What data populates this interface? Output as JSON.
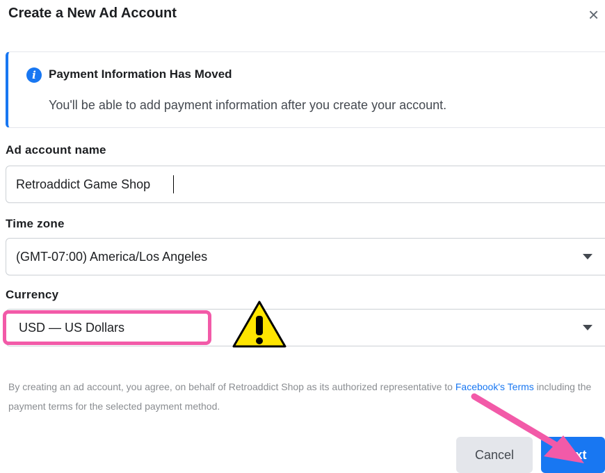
{
  "dialog": {
    "title": "Create a New Ad Account",
    "close_icon": "×"
  },
  "notice": {
    "icon": "info-icon",
    "icon_glyph": "i",
    "heading": "Payment Information Has Moved",
    "body": "You'll be able to add payment information after you create your account."
  },
  "form": {
    "account_name": {
      "label": "Ad account name",
      "value": "Retroaddict Game Shop"
    },
    "time_zone": {
      "label": "Time zone",
      "value": "(GMT-07:00) America/Los Angeles"
    },
    "currency": {
      "label": "Currency",
      "value": "USD — US Dollars"
    }
  },
  "terms": {
    "text_before": "By creating an ad account, you agree, on behalf of Retroaddict Shop as its authorized representative to ",
    "link": "Facebook's Terms",
    "text_after": " including the payment terms for the selected payment method."
  },
  "buttons": {
    "cancel": "Cancel",
    "next": "Next"
  },
  "colors": {
    "accent": "#1877f2",
    "highlight_pink": "#f25aa8",
    "warning_yellow": "#ffe500"
  },
  "annotations": {
    "warning_icon": "warning-triangle-icon",
    "arrow_icon": "pink-arrow-icon"
  }
}
